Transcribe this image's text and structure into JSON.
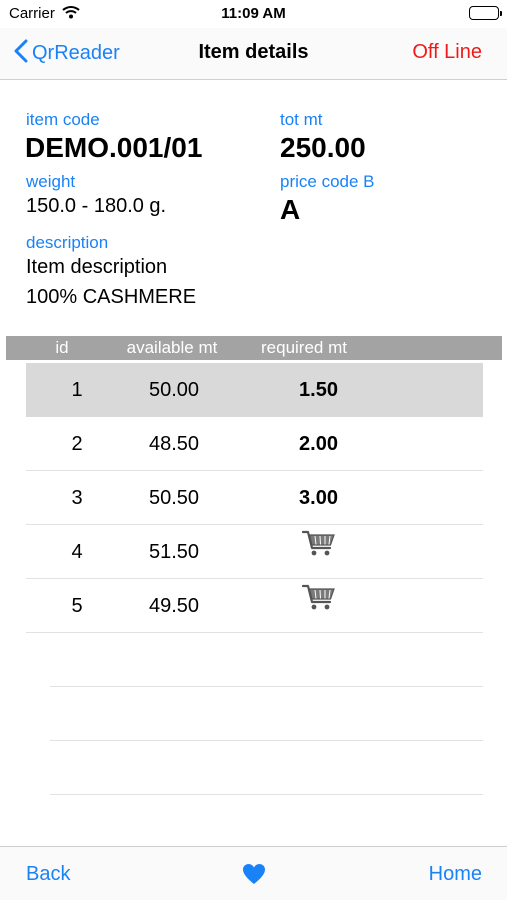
{
  "status_bar": {
    "carrier": "Carrier",
    "time": "11:09 AM"
  },
  "nav": {
    "back_label": "QrReader",
    "title": "Item details",
    "status": "Off Line"
  },
  "item": {
    "code_label": "item code",
    "code": "DEMO.001/01",
    "tot_label": "tot mt",
    "tot": "250.00",
    "weight_label": "weight",
    "weight": "150.0 - 180.0 g.",
    "price_label": "price code B",
    "price": "A",
    "description_label": "description",
    "description_line1": "Item description",
    "description_line2": "100% CASHMERE"
  },
  "table": {
    "headers": {
      "id": "id",
      "available": "available mt",
      "required": "required mt"
    },
    "rows": [
      {
        "id": "1",
        "available": "50.00",
        "required": "1.50"
      },
      {
        "id": "2",
        "available": "48.50",
        "required": "2.00"
      },
      {
        "id": "3",
        "available": "50.50",
        "required": "3.00"
      },
      {
        "id": "4",
        "available": "51.50",
        "required_icon": "cart-icon"
      },
      {
        "id": "5",
        "available": "49.50",
        "required_icon": "cart-icon"
      }
    ]
  },
  "toolbar": {
    "back_label": "Back",
    "favorite_icon": "heart-icon",
    "home_label": "Home"
  },
  "colors": {
    "accent": "#1a82f7",
    "offline": "#f01a1a",
    "header_bg": "#a3a3a3",
    "selected_row": "#d9d9d9"
  }
}
